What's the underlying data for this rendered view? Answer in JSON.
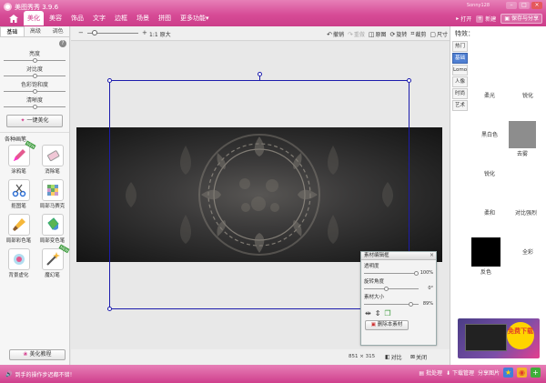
{
  "app": {
    "title": "美图秀秀 3.9.6",
    "user": "Sonny128"
  },
  "window_controls": {
    "minimize": "–",
    "maximize": "□",
    "close": "×"
  },
  "menu": {
    "home_icon": "home-icon",
    "tabs": [
      {
        "label": "美化",
        "active": true
      },
      {
        "label": "美容",
        "active": false
      },
      {
        "label": "饰品",
        "active": false
      },
      {
        "label": "文字",
        "active": false
      },
      {
        "label": "边框",
        "active": false
      },
      {
        "label": "场景",
        "active": false
      },
      {
        "label": "拼图",
        "active": false
      },
      {
        "label": "更多功能▾",
        "active": false
      }
    ]
  },
  "top_actions": {
    "open": "打开",
    "new": "新建",
    "save_share": "保存与分享"
  },
  "left_panel": {
    "subtabs": [
      "基础",
      "高级",
      "调色"
    ],
    "help": "?",
    "sliders": [
      {
        "label": "亮度",
        "value": 0.5
      },
      {
        "label": "对比度",
        "value": 0.5
      },
      {
        "label": "色彩饱和度",
        "value": 0.5
      },
      {
        "label": "清晰度",
        "value": 0.5
      }
    ],
    "one_click": "一键美化",
    "brushes_title": "各种画笔",
    "new_badge": "NEW",
    "brushes": [
      {
        "label": "涂鸦笔",
        "icon": "pen-icon",
        "is_new": true
      },
      {
        "label": "消除笔",
        "icon": "eraser-icon",
        "is_new": false
      },
      {
        "label": "抠图笔",
        "icon": "scissors-icon",
        "is_new": false
      },
      {
        "label": "局部马赛克",
        "icon": "mosaic-icon",
        "is_new": false
      },
      {
        "label": "局部彩色笔",
        "icon": "color-brush-icon",
        "is_new": false
      },
      {
        "label": "局部变色笔",
        "icon": "paint-bucket-icon",
        "is_new": false
      },
      {
        "label": "背景虚化",
        "icon": "blur-icon",
        "is_new": false
      },
      {
        "label": "魔幻笔",
        "icon": "magic-wand-icon",
        "is_new": true
      }
    ],
    "bottom_button": "美化教程"
  },
  "toolbar": {
    "zoom_minus": "−",
    "zoom_plus": "+",
    "zoom_value": 0.1,
    "zoom_actual": "1:1 原大",
    "tools": [
      {
        "label": "撤销",
        "icon": "undo-icon",
        "disabled": false
      },
      {
        "label": "重做",
        "icon": "redo-icon",
        "disabled": true
      },
      {
        "label": "原图",
        "icon": "original-icon",
        "disabled": false
      },
      {
        "label": "旋转",
        "icon": "rotate-icon",
        "disabled": false
      },
      {
        "label": "裁剪",
        "icon": "crop-icon",
        "disabled": false
      },
      {
        "label": "尺寸",
        "icon": "resize-icon",
        "disabled": false
      }
    ]
  },
  "material_panel": {
    "title": "素材编辑框",
    "close": "×",
    "rows": [
      {
        "label": "透明度",
        "value": "100%",
        "pos": 1.0
      },
      {
        "label": "旋转角度",
        "value": "0°",
        "pos": 0.4
      },
      {
        "label": "素材大小",
        "value": "89%",
        "pos": 0.89
      }
    ],
    "delete_label": "删除本素材"
  },
  "status": {
    "image_size": "851 × 315",
    "compare": "对比",
    "close": "关闭"
  },
  "right_panel": {
    "title": "特效：",
    "categories": [
      {
        "label": "热门",
        "active": false
      },
      {
        "label": "基础",
        "active": true
      },
      {
        "label": "Lomo",
        "active": false
      },
      {
        "label": "人像",
        "active": false
      },
      {
        "label": "时尚",
        "active": false
      },
      {
        "label": "艺术",
        "active": false
      }
    ],
    "effects": [
      "柔光",
      "锐化",
      "黑白色",
      "噪点",
      "锐化",
      "去雾",
      "柔和",
      "对比强烈",
      "智能绘色",
      "全彩",
      "反色"
    ],
    "ad": {
      "text": "免费下载"
    }
  },
  "statusbar": {
    "tip": "到手的操作步迟都不错！",
    "batch": "批处理",
    "download": "下载管理",
    "share": "分享图片",
    "icons": [
      "star-icon",
      "weibo-icon",
      "plus-icon"
    ]
  },
  "colors": {
    "accent": "#d43c8c",
    "selection": "#1c1cad",
    "active_category": "#4f7fd2"
  }
}
